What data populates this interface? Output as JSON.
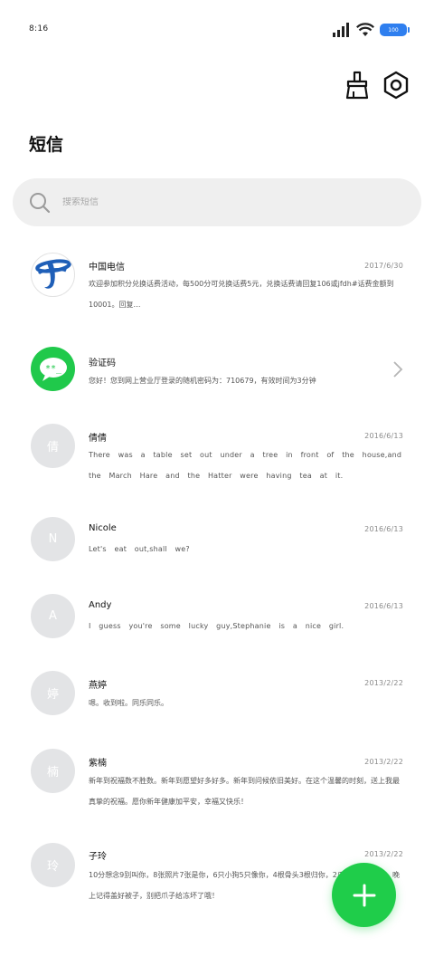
{
  "status_bar": {
    "time": "8:16",
    "battery": "100"
  },
  "toolbar": {
    "clean_icon": "broom-icon",
    "settings_icon": "hexagon-settings-icon"
  },
  "title": "短信",
  "search": {
    "placeholder": "搜索短信",
    "value": ""
  },
  "messages": [
    {
      "avatar_text": "",
      "avatar_type": "china-telecom-logo",
      "sender": "中国电信",
      "date": "2017/6/30",
      "preview": "欢迎参加积分兑换话费活动，每500分可兑换话费5元，兑换话费请回复106或jfdh#话费金额到10001。回复…"
    },
    {
      "avatar_text": "**_",
      "avatar_type": "verification-code-icon",
      "sender": "验证码",
      "date": "",
      "preview": "您好！您到网上营业厅登录的随机密码为：710679，有效时间为3分钟"
    },
    {
      "avatar_text": "倩",
      "sender": "倩倩",
      "date": "2016/6/13",
      "preview": "There was a table set out under a tree in front of the house,and the March Hare and the Hatter were having tea at it."
    },
    {
      "avatar_text": "N",
      "sender": "Nicole",
      "date": "2016/6/13",
      "preview": "Let's eat out,shall we?"
    },
    {
      "avatar_text": "A",
      "sender": "Andy",
      "date": "2016/6/13",
      "preview": "I guess you're some lucky guy,Stephanie is a nice girl."
    },
    {
      "avatar_text": "婷",
      "sender": "燕婷",
      "date": "2013/2/22",
      "preview": "嗯。收到啦。同乐同乐。"
    },
    {
      "avatar_text": "楠",
      "sender": "紫楠",
      "date": "2013/2/22",
      "preview": "新年到祝福数不胜数。新年到愿望好多好多。新年到问候依旧美好。在这个温馨的时刻，送上我最真挚的祝福。愿你新年健康加平安，幸福又快乐！"
    },
    {
      "avatar_text": "玲",
      "sender": "子玲",
      "date": "2013/2/22",
      "preview": "10分想念9别叫你，8张照片7张是你，6只小狗5只像你，4根骨头3根归你，2爪着地1爪拍你。晚上记得盖好被子，别把爪子给冻坏了哦！"
    }
  ],
  "fab": {
    "icon": "plus-icon"
  },
  "colors": {
    "accent_green": "#1fcd4a",
    "battery_blue": "#2f7fef",
    "avatar_gray": "#e3e4e6",
    "telecom_blue": "#1f5fb8"
  }
}
